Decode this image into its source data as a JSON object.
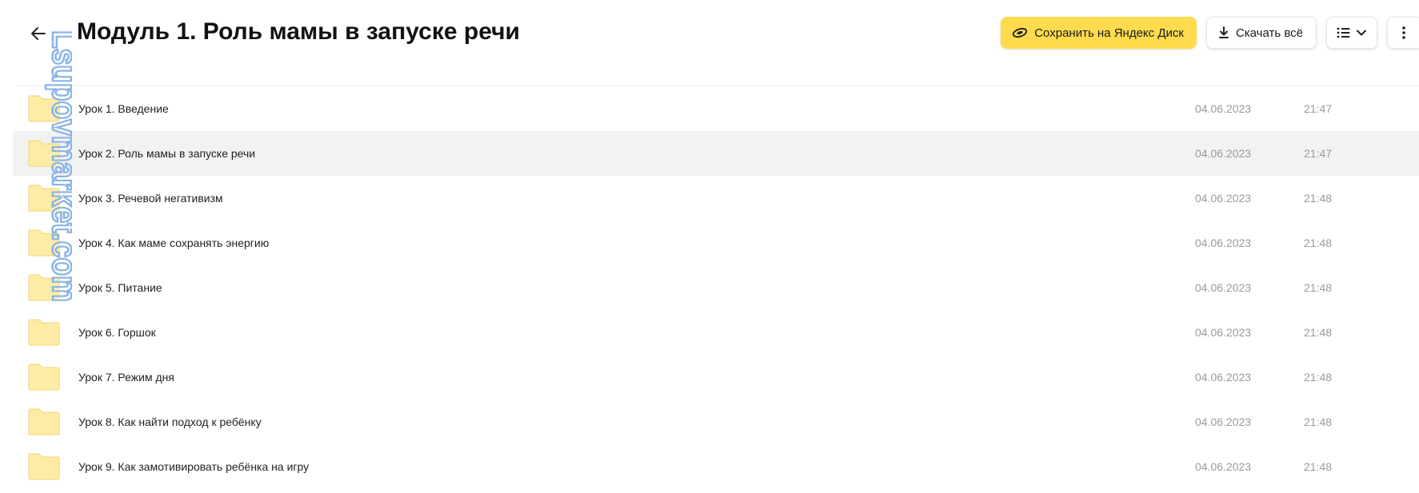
{
  "header": {
    "title": "Модуль 1. Роль мамы в запуске речи",
    "back_icon": "arrow-left-icon",
    "save_label": "Сохранить на Яндекс Диск",
    "save_icon": "yandex-disk-icon",
    "download_label": "Скачать всё",
    "download_icon": "download-icon",
    "view_icon": "list-view-icon",
    "more_icon": "more-vertical-icon"
  },
  "colors": {
    "accent": "#ffdb4d",
    "folder_fill": "#fdeca6",
    "folder_stroke": "#f2d56f",
    "hover_row": "#f2f2f2",
    "watermark": "#8ab4e6"
  },
  "watermark": {
    "text": "Lsupovmarket.com"
  },
  "items": [
    {
      "name": "Урок 1. Введение",
      "date": "04.06.2023",
      "time": "21:47",
      "icon": "folder-icon"
    },
    {
      "name": "Урок 2. Роль мамы в запуске речи",
      "date": "04.06.2023",
      "time": "21:47",
      "icon": "folder-icon"
    },
    {
      "name": "Урок 3. Речевой негативизм",
      "date": "04.06.2023",
      "time": "21:48",
      "icon": "folder-icon"
    },
    {
      "name": "Урок 4. Как маме сохранять энергию",
      "date": "04.06.2023",
      "time": "21:48",
      "icon": "folder-icon"
    },
    {
      "name": "Урок 5. Питание",
      "date": "04.06.2023",
      "time": "21:48",
      "icon": "folder-icon"
    },
    {
      "name": "Урок 6. Горшок",
      "date": "04.06.2023",
      "time": "21:48",
      "icon": "folder-icon"
    },
    {
      "name": "Урок 7. Режим дня",
      "date": "04.06.2023",
      "time": "21:48",
      "icon": "folder-icon"
    },
    {
      "name": "Урок 8. Как найти подход к ребёнку",
      "date": "04.06.2023",
      "time": "21:48",
      "icon": "folder-icon"
    },
    {
      "name": "Урок 9. Как замотивировать ребёнка на игру",
      "date": "04.06.2023",
      "time": "21:48",
      "icon": "folder-icon"
    }
  ]
}
